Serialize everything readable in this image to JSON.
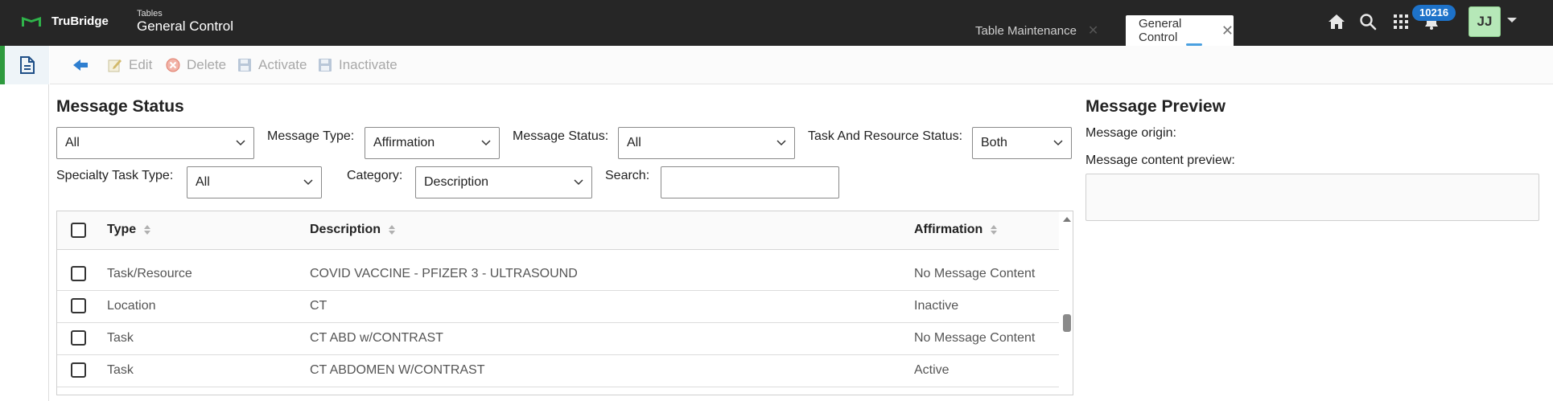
{
  "header": {
    "brand": "TruBridge",
    "subtitle": "Tables",
    "app_title": "General Control",
    "tabs": [
      {
        "label": "Table Maintenance",
        "active": false
      },
      {
        "label": "General Control",
        "active": true
      }
    ],
    "notification_count": "10216",
    "user_initials": "JJ"
  },
  "toolbar": {
    "edit_label": "Edit",
    "delete_label": "Delete",
    "activate_label": "Activate",
    "inactivate_label": "Inactivate"
  },
  "message_status": {
    "title": "Message Status",
    "filter_all_value": "All",
    "message_type_label": "Message Type:",
    "message_type_value": "Affirmation",
    "message_status_label": "Message Status:",
    "message_status_value": "All",
    "task_resource_status_label": "Task And Resource Status:",
    "task_resource_status_value": "Both",
    "specialty_task_type_label": "Specialty Task Type:",
    "specialty_task_type_value": "All",
    "category_label": "Category:",
    "category_value": "Description",
    "search_label": "Search:",
    "search_value": ""
  },
  "grid": {
    "columns": [
      "Type",
      "Description",
      "Affirmation"
    ],
    "rows": [
      {
        "type": "Task/Resource",
        "description": "COVID VACCINE - PFIZER 3 - ULTRASOUND",
        "affirmation": "No Message Content"
      },
      {
        "type": "Location",
        "description": "CT",
        "affirmation": "Inactive"
      },
      {
        "type": "Task",
        "description": "CT ABD w/CONTRAST",
        "affirmation": "No Message Content"
      },
      {
        "type": "Task",
        "description": "CT ABDOMEN W/CONTRAST",
        "affirmation": "Active"
      }
    ]
  },
  "preview": {
    "title": "Message Preview",
    "origin_label": "Message origin:",
    "content_label": "Message content preview:"
  },
  "colors": {
    "topbar": "#262626",
    "brand_green": "#2e9a3e",
    "badge_blue": "#1d72c9",
    "avatar_green": "#b6e8b8"
  }
}
